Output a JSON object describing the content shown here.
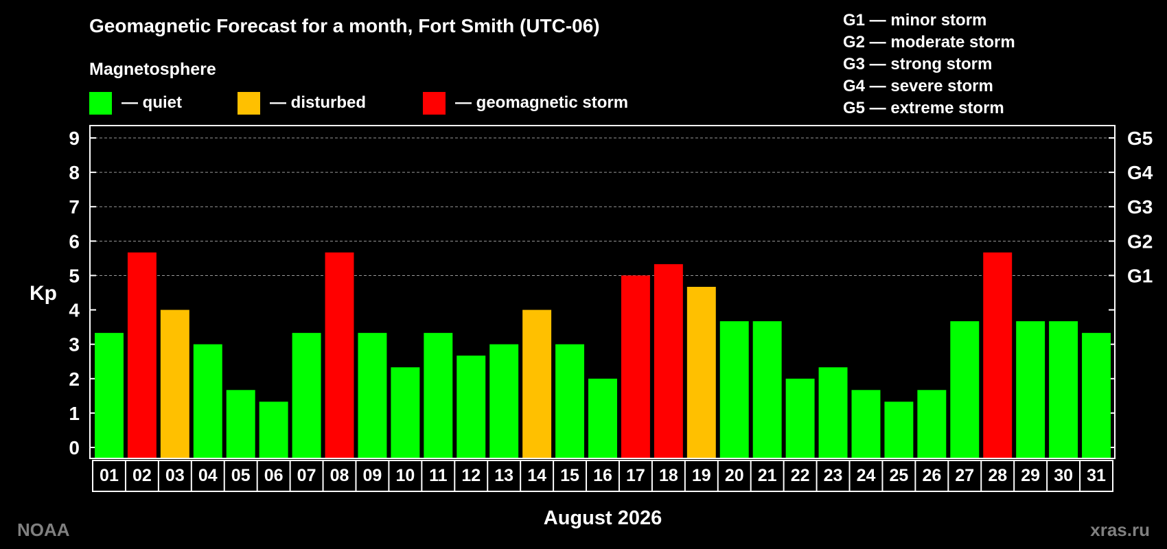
{
  "title": "Geomagnetic Forecast for a month, Fort Smith (UTC-06)",
  "legend": {
    "heading": "Magnetosphere",
    "items": [
      {
        "label": "— quiet",
        "color": "#00ff00"
      },
      {
        "label": "— disturbed",
        "color": "#ffc000"
      },
      {
        "label": "— geomagnetic storm",
        "color": "#ff0000"
      }
    ],
    "storm_scale": [
      "G1 — minor storm",
      "G2 — moderate storm",
      "G3 — strong storm",
      "G4 — severe storm",
      "G5 — extreme storm"
    ]
  },
  "footer": {
    "left": "NOAA",
    "right": "xras.ru"
  },
  "chart_data": {
    "type": "bar",
    "xlabel": "August 2026",
    "ylabel": "Kp",
    "ylim": [
      0,
      9
    ],
    "yticks": [
      "0",
      "1",
      "2",
      "3",
      "4",
      "5",
      "6",
      "7",
      "8",
      "9"
    ],
    "right_axis_labels": [
      {
        "value": 5,
        "label": "G1"
      },
      {
        "value": 6,
        "label": "G2"
      },
      {
        "value": 7,
        "label": "G3"
      },
      {
        "value": 8,
        "label": "G4"
      },
      {
        "value": 9,
        "label": "G5"
      }
    ],
    "grid": "dashed horizontal at Kp 5-9",
    "categories": [
      "01",
      "02",
      "03",
      "04",
      "05",
      "06",
      "07",
      "08",
      "09",
      "10",
      "11",
      "12",
      "13",
      "14",
      "15",
      "16",
      "17",
      "18",
      "19",
      "20",
      "21",
      "22",
      "23",
      "24",
      "25",
      "26",
      "27",
      "28",
      "29",
      "30",
      "31"
    ],
    "values": [
      3.33,
      5.67,
      4.0,
      3.0,
      1.67,
      1.33,
      3.33,
      5.67,
      3.33,
      2.33,
      3.33,
      2.67,
      3.0,
      4.0,
      3.0,
      2.0,
      5.0,
      5.33,
      4.67,
      3.67,
      3.67,
      2.0,
      2.33,
      1.67,
      1.33,
      1.67,
      3.67,
      5.67,
      3.67,
      3.67,
      3.33
    ],
    "levels": [
      "quiet",
      "storm",
      "disturbed",
      "quiet",
      "quiet",
      "quiet",
      "quiet",
      "storm",
      "quiet",
      "quiet",
      "quiet",
      "quiet",
      "quiet",
      "disturbed",
      "quiet",
      "quiet",
      "storm",
      "storm",
      "disturbed",
      "quiet",
      "quiet",
      "quiet",
      "quiet",
      "quiet",
      "quiet",
      "quiet",
      "quiet",
      "storm",
      "quiet",
      "quiet",
      "quiet"
    ],
    "colors": {
      "quiet": "#00ff00",
      "disturbed": "#ffc000",
      "storm": "#ff0000"
    }
  }
}
